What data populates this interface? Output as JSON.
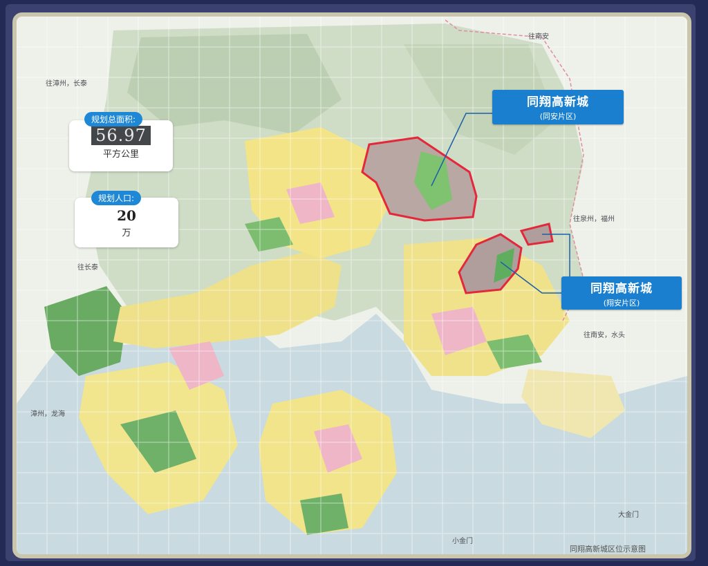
{
  "stats": {
    "area": {
      "label": "规划总面积:",
      "value": "56.97",
      "unit": "平方公里"
    },
    "population": {
      "label": "规划人口:",
      "value": "20",
      "unit": "万"
    }
  },
  "callouts": [
    {
      "title": "同翔高新城",
      "subtitle": "(同安片区)"
    },
    {
      "title": "同翔高新城",
      "subtitle": "(翔安片区)"
    }
  ],
  "places": {
    "nanan": "往南安",
    "zhangzhou_changtai": "往漳州，长泰",
    "quanzhou_fuzhou": "往泉州，福州",
    "changtai": "往长泰",
    "nanan_shuitou": "往南安，水头",
    "zhangzhou_longhai": "漳州，龙海",
    "dajinmen": "大金门",
    "xiaojinmen": "小金门"
  },
  "footer": "同翔高新城区位示意图",
  "colors": {
    "sea": "#c5d6de",
    "land": "#e9eadc",
    "urban_yellow": "#f1e87a",
    "urban_pink": "#f0b7c9",
    "green": "#7fbf73",
    "highlight_outline": "#e2283a",
    "callout_blue": "#1b7fd0",
    "label_blue": "#1e88d6"
  }
}
